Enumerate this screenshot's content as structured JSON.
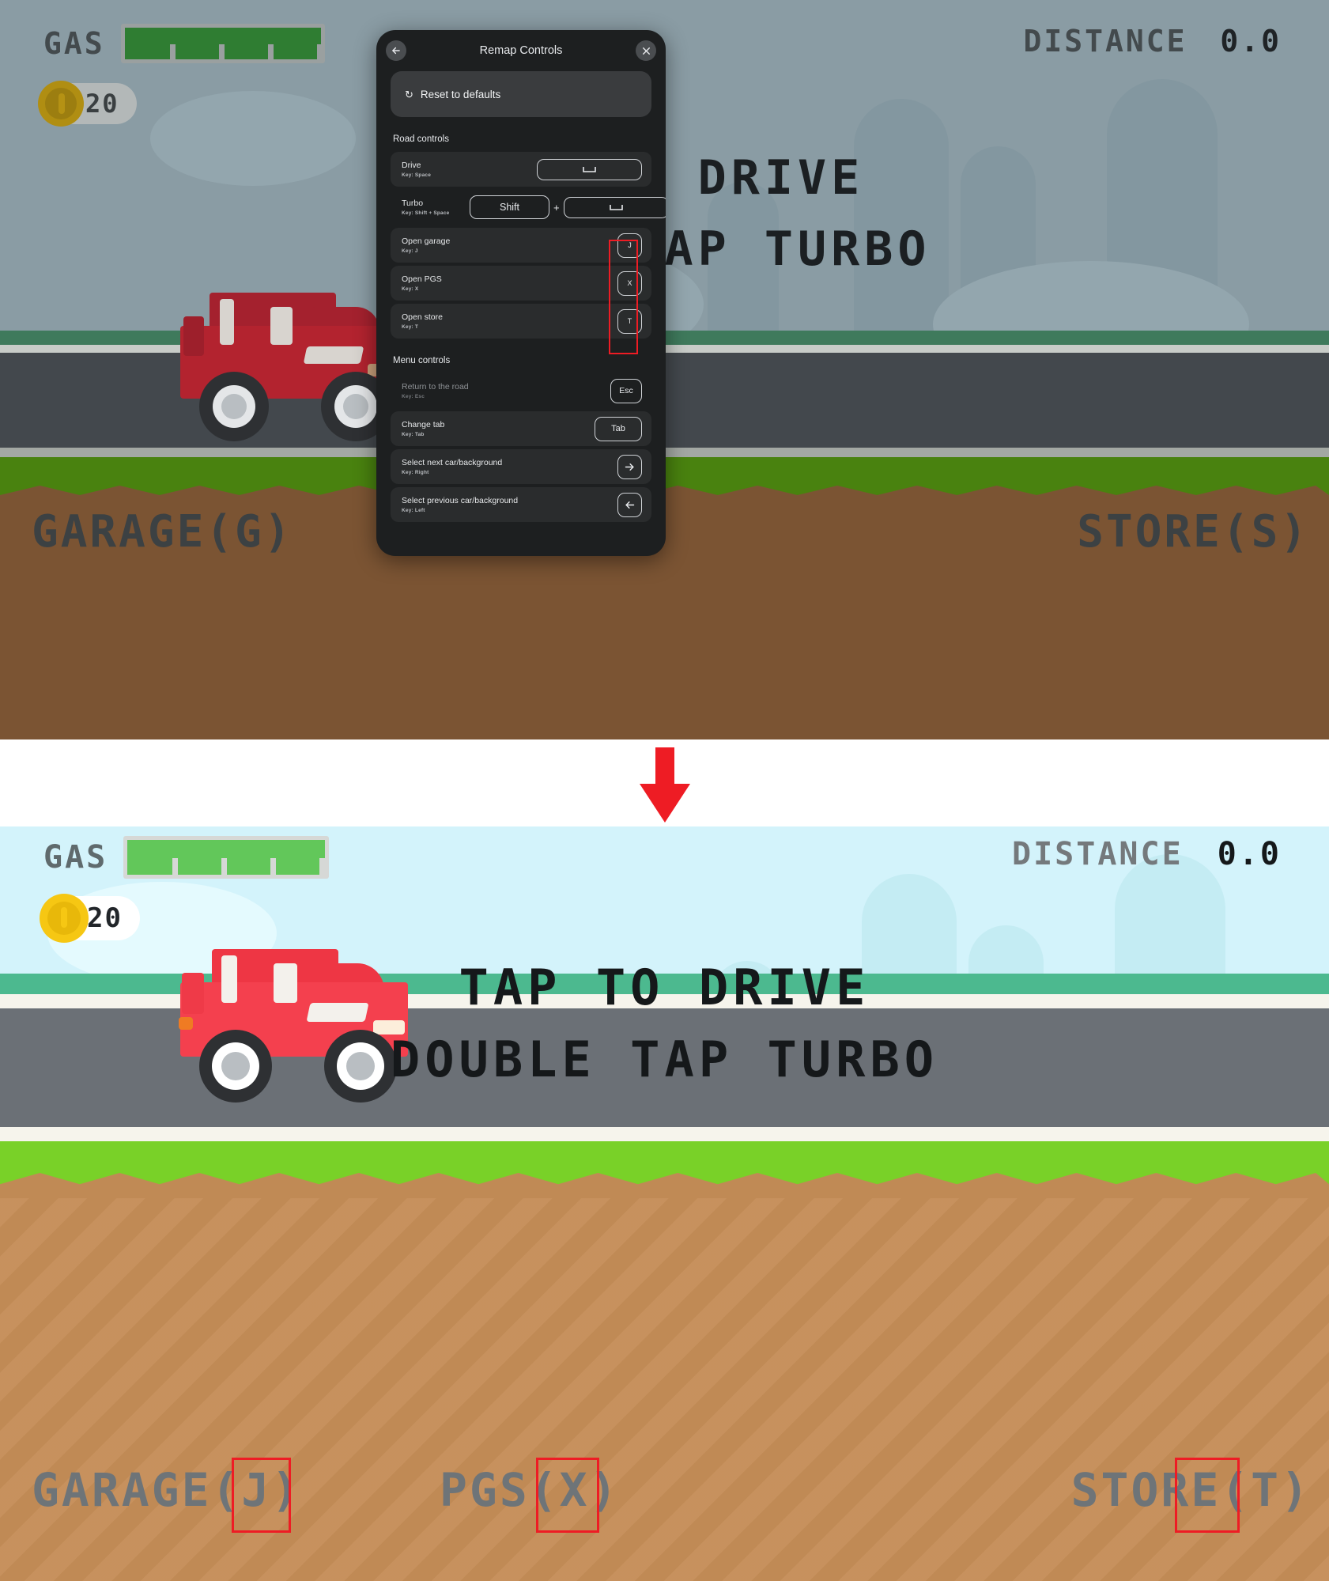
{
  "game": {
    "hud": {
      "gas_label": "GAS",
      "gas_percent": 100,
      "coins": "20",
      "distance_label": "DISTANCE",
      "distance_value": "0.0"
    },
    "center_text": {
      "line1": "TAP TO DRIVE",
      "line2": "DOUBLE TAP TURBO"
    },
    "nav_before": [
      {
        "label": "GARAGE(G)",
        "key": "G",
        "highlighted": false
      },
      {
        "label": "STORE(S)",
        "key": "S",
        "highlighted": false
      }
    ],
    "nav_after": [
      {
        "label": "GARAGE(J)",
        "key": "J",
        "highlighted": true
      },
      {
        "label": "PGS(X)",
        "key": "X",
        "highlighted": true
      },
      {
        "label": "STORE(T)",
        "key": "T",
        "highlighted": true
      }
    ],
    "colors": {
      "sky": "#d3f3fb",
      "grass": "#6bc42e",
      "dirt": "#c08a55",
      "road": "#6b7076",
      "car_red": "#e8313f",
      "gas_green": "#62c75a",
      "coin_gold": "#f6c713",
      "highlight_red": "#ee1c24"
    }
  },
  "modal": {
    "title": "Remap Controls",
    "back_icon": "arrow-left-icon",
    "close_icon": "close-icon",
    "reset": {
      "icon": "reset-icon",
      "label": "Reset to defaults"
    },
    "sections": [
      {
        "title": "Road controls",
        "rows": [
          {
            "name": "Drive",
            "key_text": "Key: Space",
            "caps": [
              {
                "type": "space",
                "label": "␣"
              }
            ],
            "highlighted": false,
            "dimmed": false,
            "filled": true
          },
          {
            "name": "Turbo",
            "key_text": "Key: Shift + Space",
            "caps": [
              {
                "type": "shift",
                "label": "Shift"
              },
              {
                "type": "space",
                "label": "␣"
              }
            ],
            "separator": "+",
            "highlighted": false,
            "dimmed": false,
            "filled": false
          },
          {
            "name": "Open garage",
            "key_text": "Key: J",
            "caps": [
              {
                "type": "sq",
                "label": "J"
              }
            ],
            "highlighted": true,
            "dimmed": false,
            "filled": true
          },
          {
            "name": "Open PGS",
            "key_text": "Key: X",
            "caps": [
              {
                "type": "sq",
                "label": "X"
              }
            ],
            "highlighted": true,
            "dimmed": false,
            "filled": true
          },
          {
            "name": "Open store",
            "key_text": "Key: T",
            "caps": [
              {
                "type": "sq",
                "label": "T"
              }
            ],
            "highlighted": true,
            "dimmed": false,
            "filled": true
          }
        ]
      },
      {
        "title": "Menu controls",
        "rows": [
          {
            "name": "Return to the road",
            "key_text": "Key: Esc",
            "caps": [
              {
                "type": "esc",
                "label": "Esc"
              }
            ],
            "highlighted": false,
            "dimmed": true,
            "filled": false
          },
          {
            "name": "Change tab",
            "key_text": "Key: Tab",
            "caps": [
              {
                "type": "tab",
                "label": "Tab"
              }
            ],
            "highlighted": false,
            "dimmed": false,
            "filled": true
          },
          {
            "name": "Select next car/background",
            "key_text": "Key: Right",
            "caps": [
              {
                "type": "sq",
                "label": "→"
              }
            ],
            "highlighted": false,
            "dimmed": false,
            "filled": true
          },
          {
            "name": "Select previous car/background",
            "key_text": "Key: Left",
            "caps": [
              {
                "type": "sq",
                "label": "←"
              }
            ],
            "highlighted": false,
            "dimmed": false,
            "filled": true
          }
        ]
      }
    ]
  },
  "flow": {
    "arrow_icon": "down-arrow-icon",
    "arrow_color": "#ee1c24"
  }
}
